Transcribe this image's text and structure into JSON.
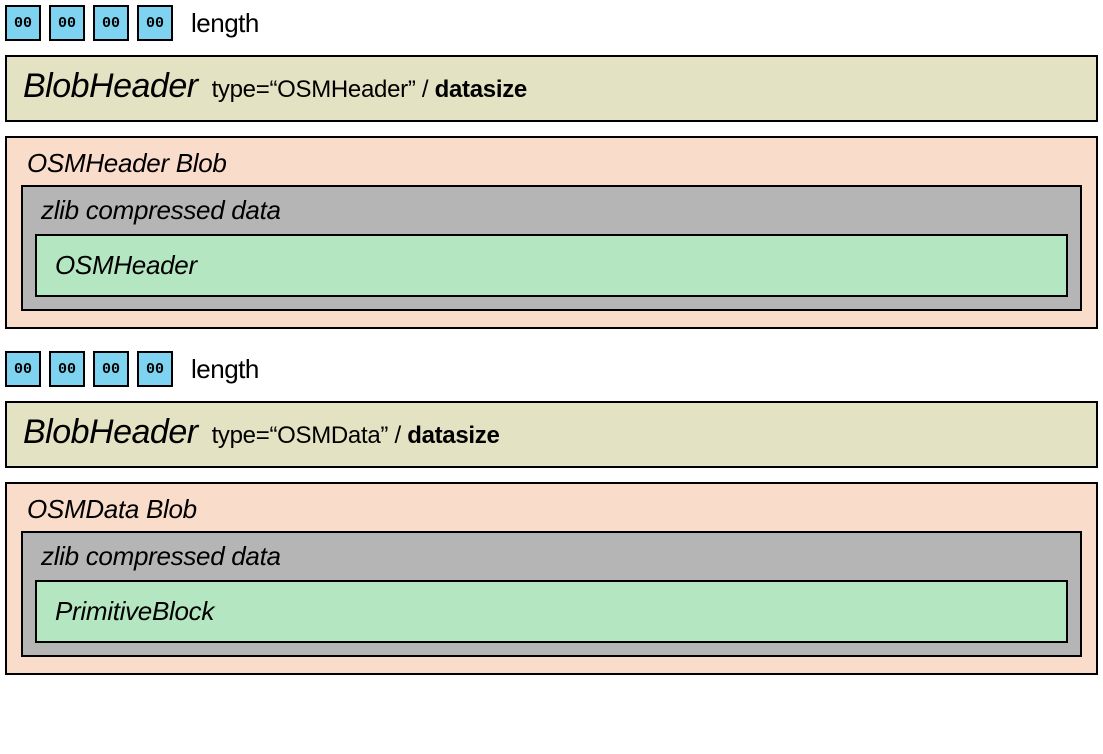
{
  "section1": {
    "bytes": [
      "00",
      "00",
      "00",
      "00"
    ],
    "length_label": "length",
    "blobheader": {
      "title": "BlobHeader",
      "type_text": "type=“OSMHeader” / ",
      "datasize": "datasize"
    },
    "blob": {
      "title": "OSMHeader Blob",
      "zlib_title": "zlib compressed data",
      "inner_title": "OSMHeader"
    }
  },
  "section2": {
    "bytes": [
      "00",
      "00",
      "00",
      "00"
    ],
    "length_label": "length",
    "blobheader": {
      "title": "BlobHeader",
      "type_text": "type=“OSMData” / ",
      "datasize": "datasize"
    },
    "blob": {
      "title": "OSMData Blob",
      "zlib_title": "zlib compressed data",
      "inner_title": "PrimitiveBlock"
    }
  }
}
